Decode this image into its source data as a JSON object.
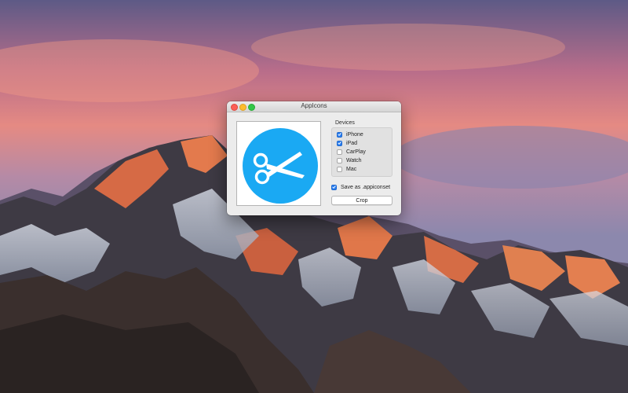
{
  "window": {
    "title": "AppIcons"
  },
  "image_well": {
    "icon": "scissors-icon",
    "icon_color": "#1aa9f3"
  },
  "devices": {
    "label": "Devices",
    "items": [
      {
        "label": "iPhone",
        "checked": true
      },
      {
        "label": "iPad",
        "checked": true
      },
      {
        "label": "CarPlay",
        "checked": false
      },
      {
        "label": "Watch",
        "checked": false
      },
      {
        "label": "Mac",
        "checked": false
      }
    ]
  },
  "options": {
    "save_appiconset_label": "Save as .appiconset",
    "save_appiconset_checked": true
  },
  "actions": {
    "crop_label": "Crop"
  },
  "colors": {
    "accent": "#2a7ef0",
    "close": "#fc5f57",
    "minimize": "#fdbc2e",
    "zoom": "#33c748"
  }
}
